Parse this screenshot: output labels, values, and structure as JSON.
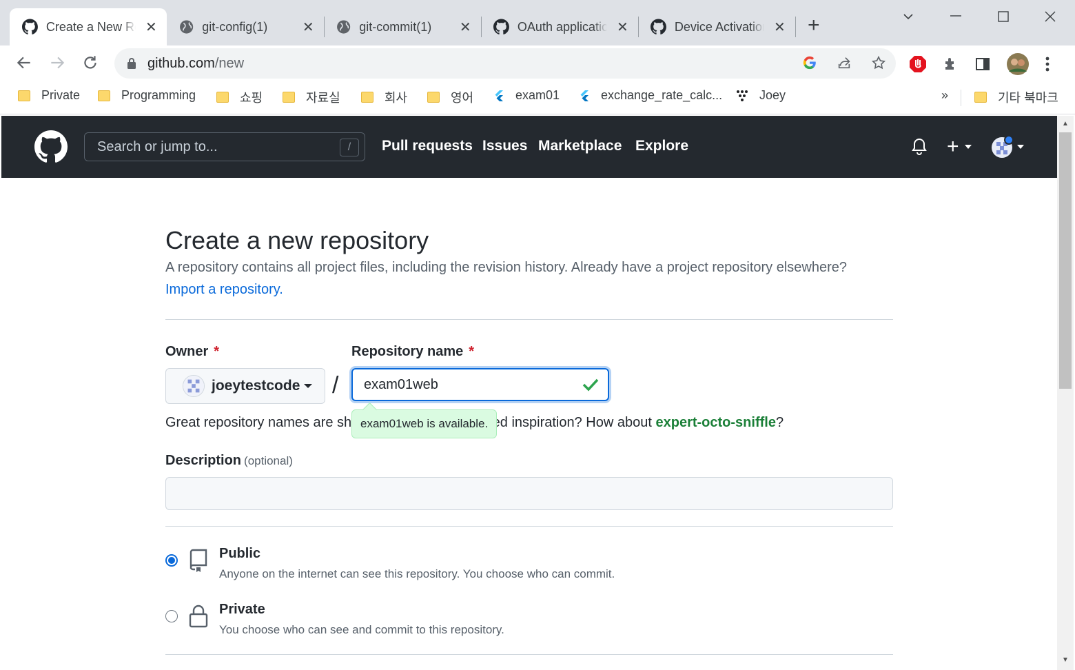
{
  "browser": {
    "tabs": [
      {
        "title": "Create a New Repository",
        "icon": "github-icon",
        "active": true
      },
      {
        "title": "git-config(1)",
        "icon": "globe-icon",
        "active": false
      },
      {
        "title": "git-commit(1)",
        "icon": "globe-icon",
        "active": false
      },
      {
        "title": "OAuth applications",
        "icon": "github-icon",
        "active": false
      },
      {
        "title": "Device Activation",
        "icon": "github-icon",
        "active": false
      }
    ],
    "new_tab_label": "+",
    "url_host": "github.com",
    "url_path": "/new",
    "bookmarks": [
      {
        "label": "Private",
        "icon": "folder-icon"
      },
      {
        "label": "Programming",
        "icon": "folder-icon"
      },
      {
        "label": "쇼핑",
        "icon": "folder-icon"
      },
      {
        "label": "자료실",
        "icon": "folder-icon"
      },
      {
        "label": "회사",
        "icon": "folder-icon"
      },
      {
        "label": "영어",
        "icon": "folder-icon"
      },
      {
        "label": "exam01",
        "icon": "flutter-icon"
      },
      {
        "label": "exchange_rate_calc...",
        "icon": "flutter-icon"
      },
      {
        "label": "Joey",
        "icon": "dots-icon"
      }
    ],
    "bookmarks_overflow": "»",
    "other_bookmarks": "기타 북마크"
  },
  "github": {
    "search_placeholder": "Search or jump to...",
    "search_shortcut": "/",
    "nav": [
      "Pull requests",
      "Issues",
      "Marketplace",
      "Explore"
    ],
    "plus_label": "+"
  },
  "page": {
    "title": "Create a new repository",
    "subtitle": "A repository contains all project files, including the revision history. Already have a project repository elsewhere?",
    "import_link": "Import a repository.",
    "owner_label": "Owner",
    "required_mark": "*",
    "owner_value": "joeytestcode",
    "separator": "/",
    "repo_name_label": "Repository name",
    "repo_name_value": "exam01web",
    "hint_prefix": "Great repository names are short and memorable. Need inspiration? How about ",
    "hint_suggestion": "expert-octo-sniffle",
    "hint_suffix": "?",
    "availability": "exam01web is available.",
    "description_label": "Description",
    "description_optional": "(optional)",
    "description_value": "",
    "visibility": [
      {
        "title": "Public",
        "desc": "Anyone on the internet can see this repository. You choose who can commit.",
        "checked": true
      },
      {
        "title": "Private",
        "desc": "You choose who can see and commit to this repository.",
        "checked": false
      }
    ]
  },
  "colors": {
    "header_bg": "#24292f",
    "link": "#0969da",
    "success": "#1a7f37",
    "required": "#cf222e"
  }
}
